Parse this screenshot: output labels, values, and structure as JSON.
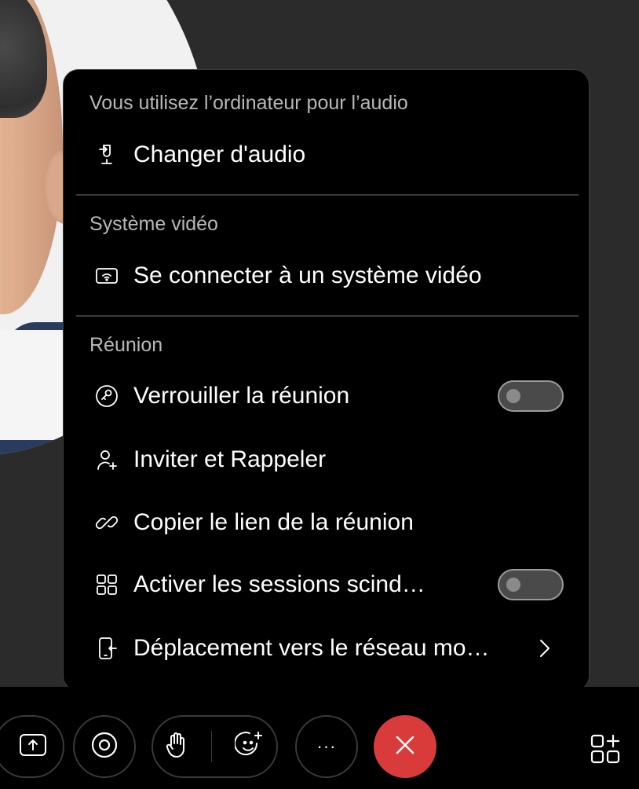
{
  "menu": {
    "sections": {
      "audio": {
        "title": "Vous utilisez l’ordinateur pour l’audio",
        "change_audio": "Changer d'audio"
      },
      "video_system": {
        "title": "Système vidéo",
        "connect": "Se connecter à un système vidéo"
      },
      "meeting": {
        "title": "Réunion",
        "lock": "Verrouiller la réunion",
        "lock_toggle": "off",
        "invite": "Inviter et Rappeler",
        "copy_link": "Copier le lien de la réunion",
        "breakout": "Activer les sessions scind…",
        "breakout_toggle": "off",
        "move_mobile": "Déplacement vers le réseau mo…"
      }
    }
  },
  "toolbar": {
    "more_label": "···",
    "buttons": [
      "share-icon",
      "camera-icon",
      "raise-hand-icon",
      "reactions-icon",
      "more-icon",
      "end-call-icon",
      "apps-icon"
    ]
  },
  "colors": {
    "end_call": "#d93b3b",
    "menu_bg": "#000000",
    "section_title": "#b8b8b8"
  }
}
